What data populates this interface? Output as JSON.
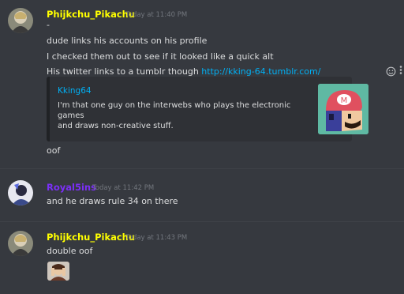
{
  "messages": [
    {
      "username": "Phijkchu_Pikachu",
      "username_color": "#ffff00",
      "timestamp": "Today at 11:40 PM",
      "lines": [
        "-",
        "dude links his accounts on his profile",
        "I checked them out to see if it looked like a quick alt",
        "His twitter links to a tumblr though "
      ],
      "link": "http://kking-64.tumblr.com/",
      "embed": {
        "title": "Kking64",
        "description_line1": "I'm that one guy on the interwebs who plays the electronic games",
        "description_line2": "and draws non-creative stuff."
      },
      "followup": "oof"
    },
    {
      "username": "Royal5ins",
      "username_color": "#7b2ff7",
      "timestamp": "Today at 11:42 PM",
      "lines": [
        "and he draws rule 34 on there"
      ]
    },
    {
      "username": "Phijkchu_Pikachu",
      "username_color": "#ffff00",
      "timestamp": "Today at 11:43 PM",
      "lines": [
        "double oof"
      ]
    }
  ],
  "icons": {
    "add_reaction": "add-reaction-icon",
    "more": "more-options-icon"
  }
}
